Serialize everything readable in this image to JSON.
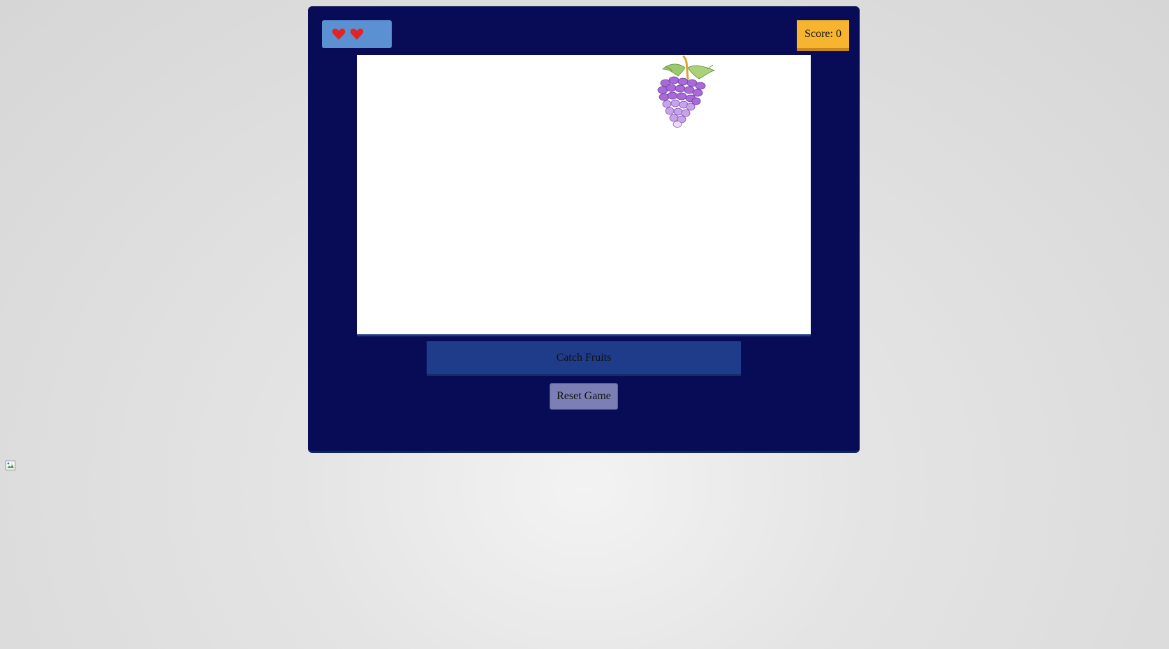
{
  "hud": {
    "lives": 2,
    "score_label": "Score: 0",
    "heart_color": "#e02424",
    "lives_bg": "#5b91d2",
    "score_bg": "#f7b52f"
  },
  "play_area": {
    "falling_fruit": "grape-icon"
  },
  "catch_bar": {
    "label": "Catch Fruits"
  },
  "controls": {
    "reset_label": "Reset Game"
  },
  "colors": {
    "window_bg": "#080c56",
    "catch_bar_bg": "#1f3c8a",
    "reset_bg": "#7c7fb3"
  },
  "icons": {
    "broken_image": "broken-image-icon"
  }
}
